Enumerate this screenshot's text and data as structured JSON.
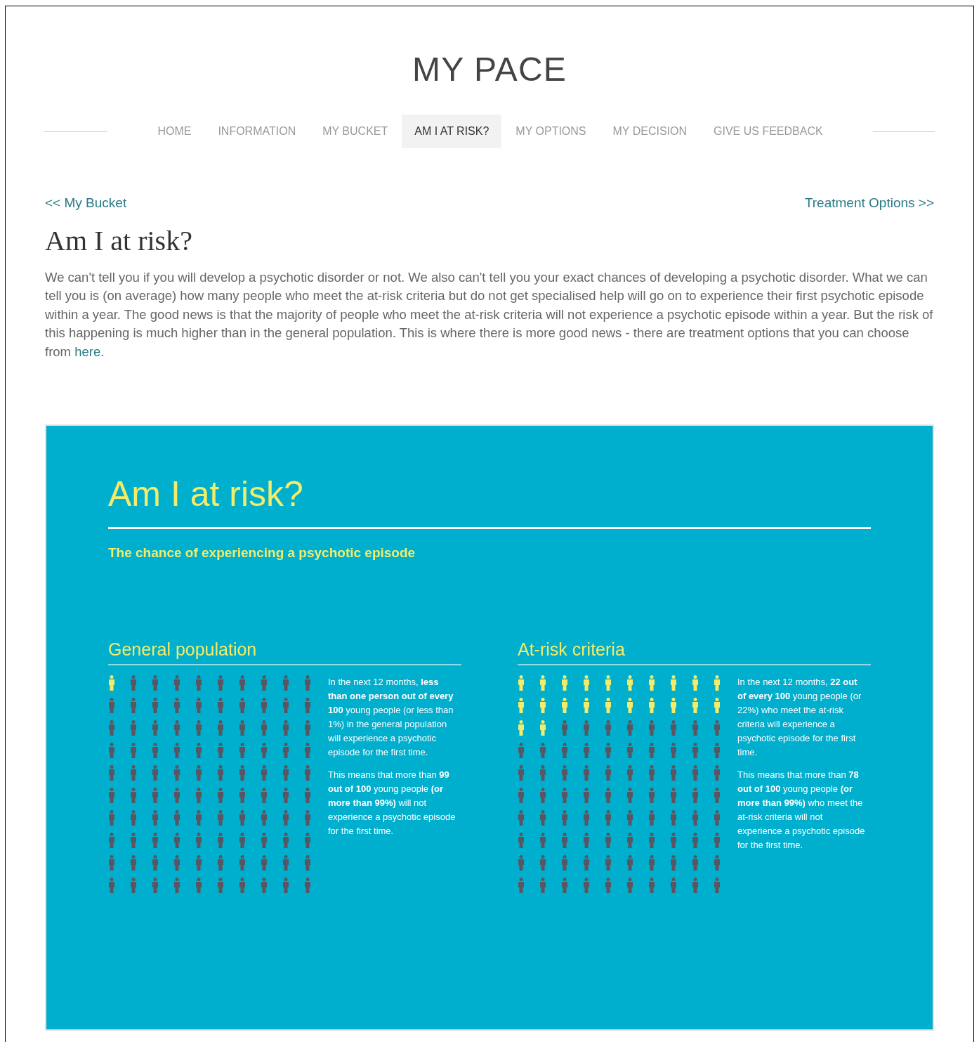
{
  "site_title": "MY PACE",
  "nav": [
    {
      "label": "HOME",
      "selected": false
    },
    {
      "label": "INFORMATION",
      "selected": false
    },
    {
      "label": "MY BUCKET",
      "selected": false
    },
    {
      "label": "AM I AT RISK?",
      "selected": true
    },
    {
      "label": "MY OPTIONS",
      "selected": false
    },
    {
      "label": "MY DECISION",
      "selected": false
    },
    {
      "label": "GIVE US FEEDBACK",
      "selected": false
    }
  ],
  "prev_link": "<< My Bucket",
  "next_link": "Treatment Options >>",
  "heading": "Am I at risk?",
  "intro": "We can't tell you if you will develop a psychotic disorder or not. We also can't tell you your exact chances of developing a psychotic disorder. What we can tell you is (on average) how many people who meet the at-risk criteria but do not get specialised help will go on to experience their first psychotic episode within a year. The good news is that the majority of people who meet the at-risk criteria will not experience a psychotic episode within a year. But the risk of this happening is much higher than in the general population. This is where there is more good news - there are treatment options that you can choose from",
  "intro_link": "here.",
  "infographic": {
    "title": "Am I at risk?",
    "subtitle": "The chance of experiencing a psychotic episode",
    "panels": [
      {
        "title": "General population",
        "paragraphs": [
          "In the next 12 months, **less than one person out of every 100** young people (or less than 1%) in the general population will experience a psychotic episode for the first time.",
          "This means that more than **99 out of 100** young people **(or more than 99%)** will not experience a psychotic episode for the first time."
        ]
      },
      {
        "title": "At-risk criteria",
        "paragraphs": [
          "In the next 12 months, **22 out of every 100** young people (or 22%) who meet the at-risk criteria will experience a psychotic episode for the first time.",
          "This means that more than **78 out of 100** young people **(or more than 99%)** who meet the at-risk criteria will not experience a psychotic episode for the first time."
        ]
      }
    ]
  }
}
